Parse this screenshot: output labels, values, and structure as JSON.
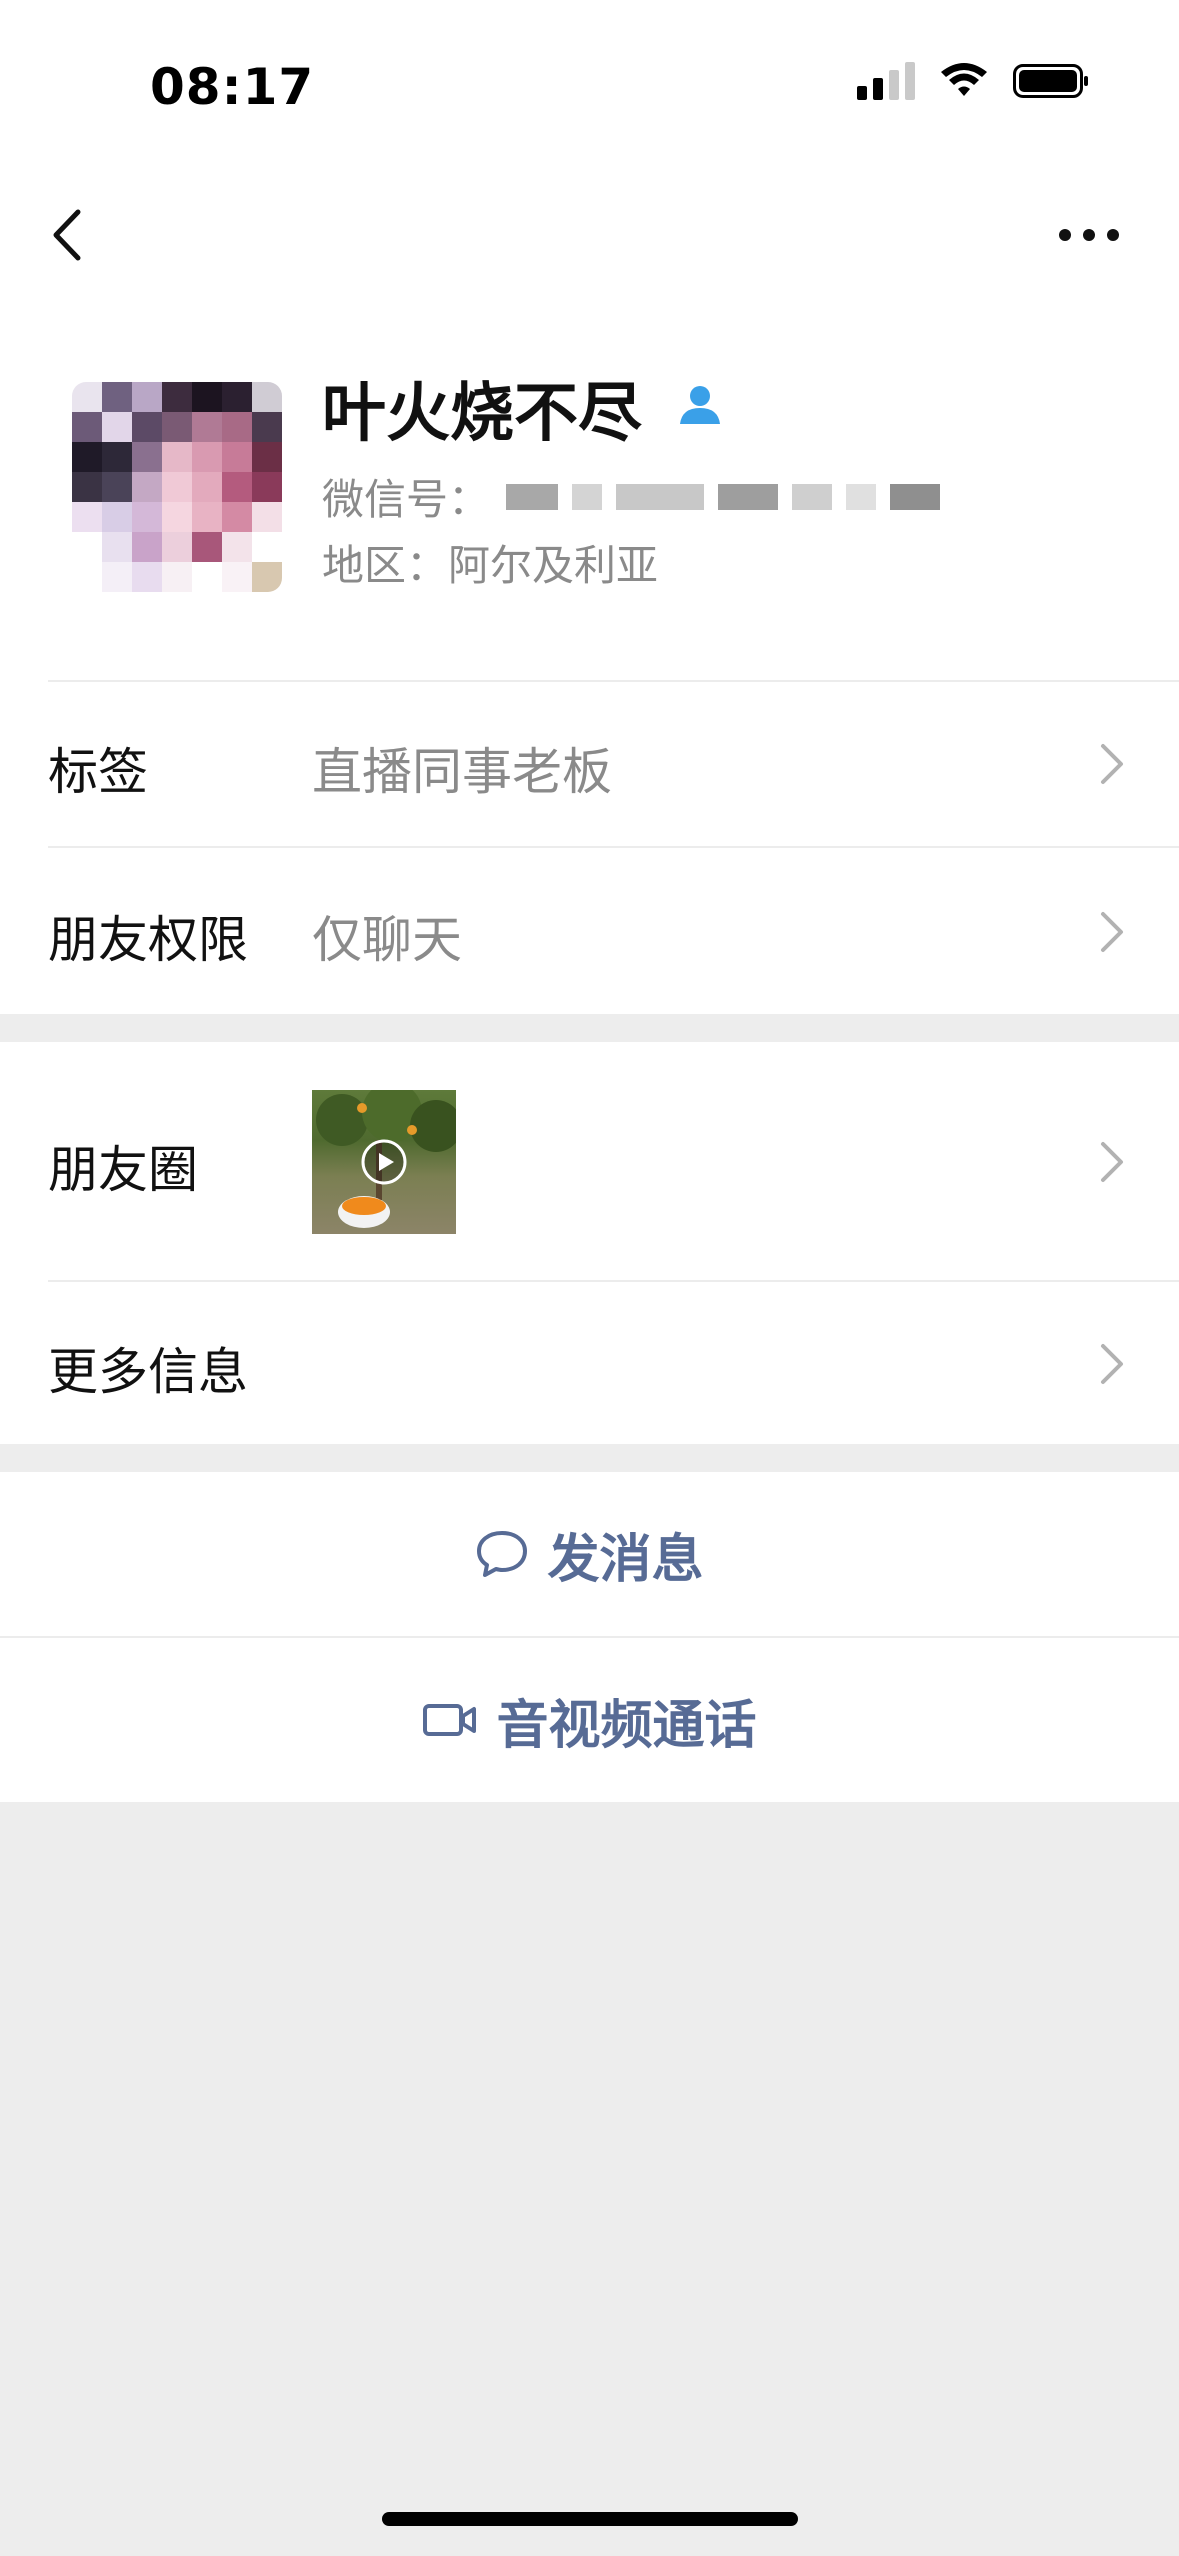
{
  "status_bar": {
    "time": "08:17",
    "icons": [
      "cellular-signal-icon",
      "wifi-icon",
      "battery-icon"
    ]
  },
  "nav": {
    "back_icon": "chevron-left-icon",
    "more_icon": "ellipsis-icon"
  },
  "profile": {
    "name": "叶火烧不尽",
    "badge_icon": "person-icon",
    "wechat_id_label": "微信号：",
    "region": "地区：阿尔及利亚"
  },
  "cells": {
    "tags": {
      "label": "标签",
      "value": "直播同事老板"
    },
    "permissions": {
      "label": "朋友权限",
      "value": "仅聊天"
    },
    "moments": {
      "label": "朋友圈",
      "thumb_icon": "play-icon"
    },
    "more_info": {
      "label": "更多信息"
    }
  },
  "actions": {
    "message": {
      "label": "发消息",
      "icon": "chat-bubble-icon"
    },
    "call": {
      "label": "音视频通话",
      "icon": "video-camera-icon"
    }
  },
  "colors": {
    "link": "#576b95",
    "secondary_text": "#8a8a8a",
    "background": "#ededed",
    "badge": "#3aa0e8"
  }
}
